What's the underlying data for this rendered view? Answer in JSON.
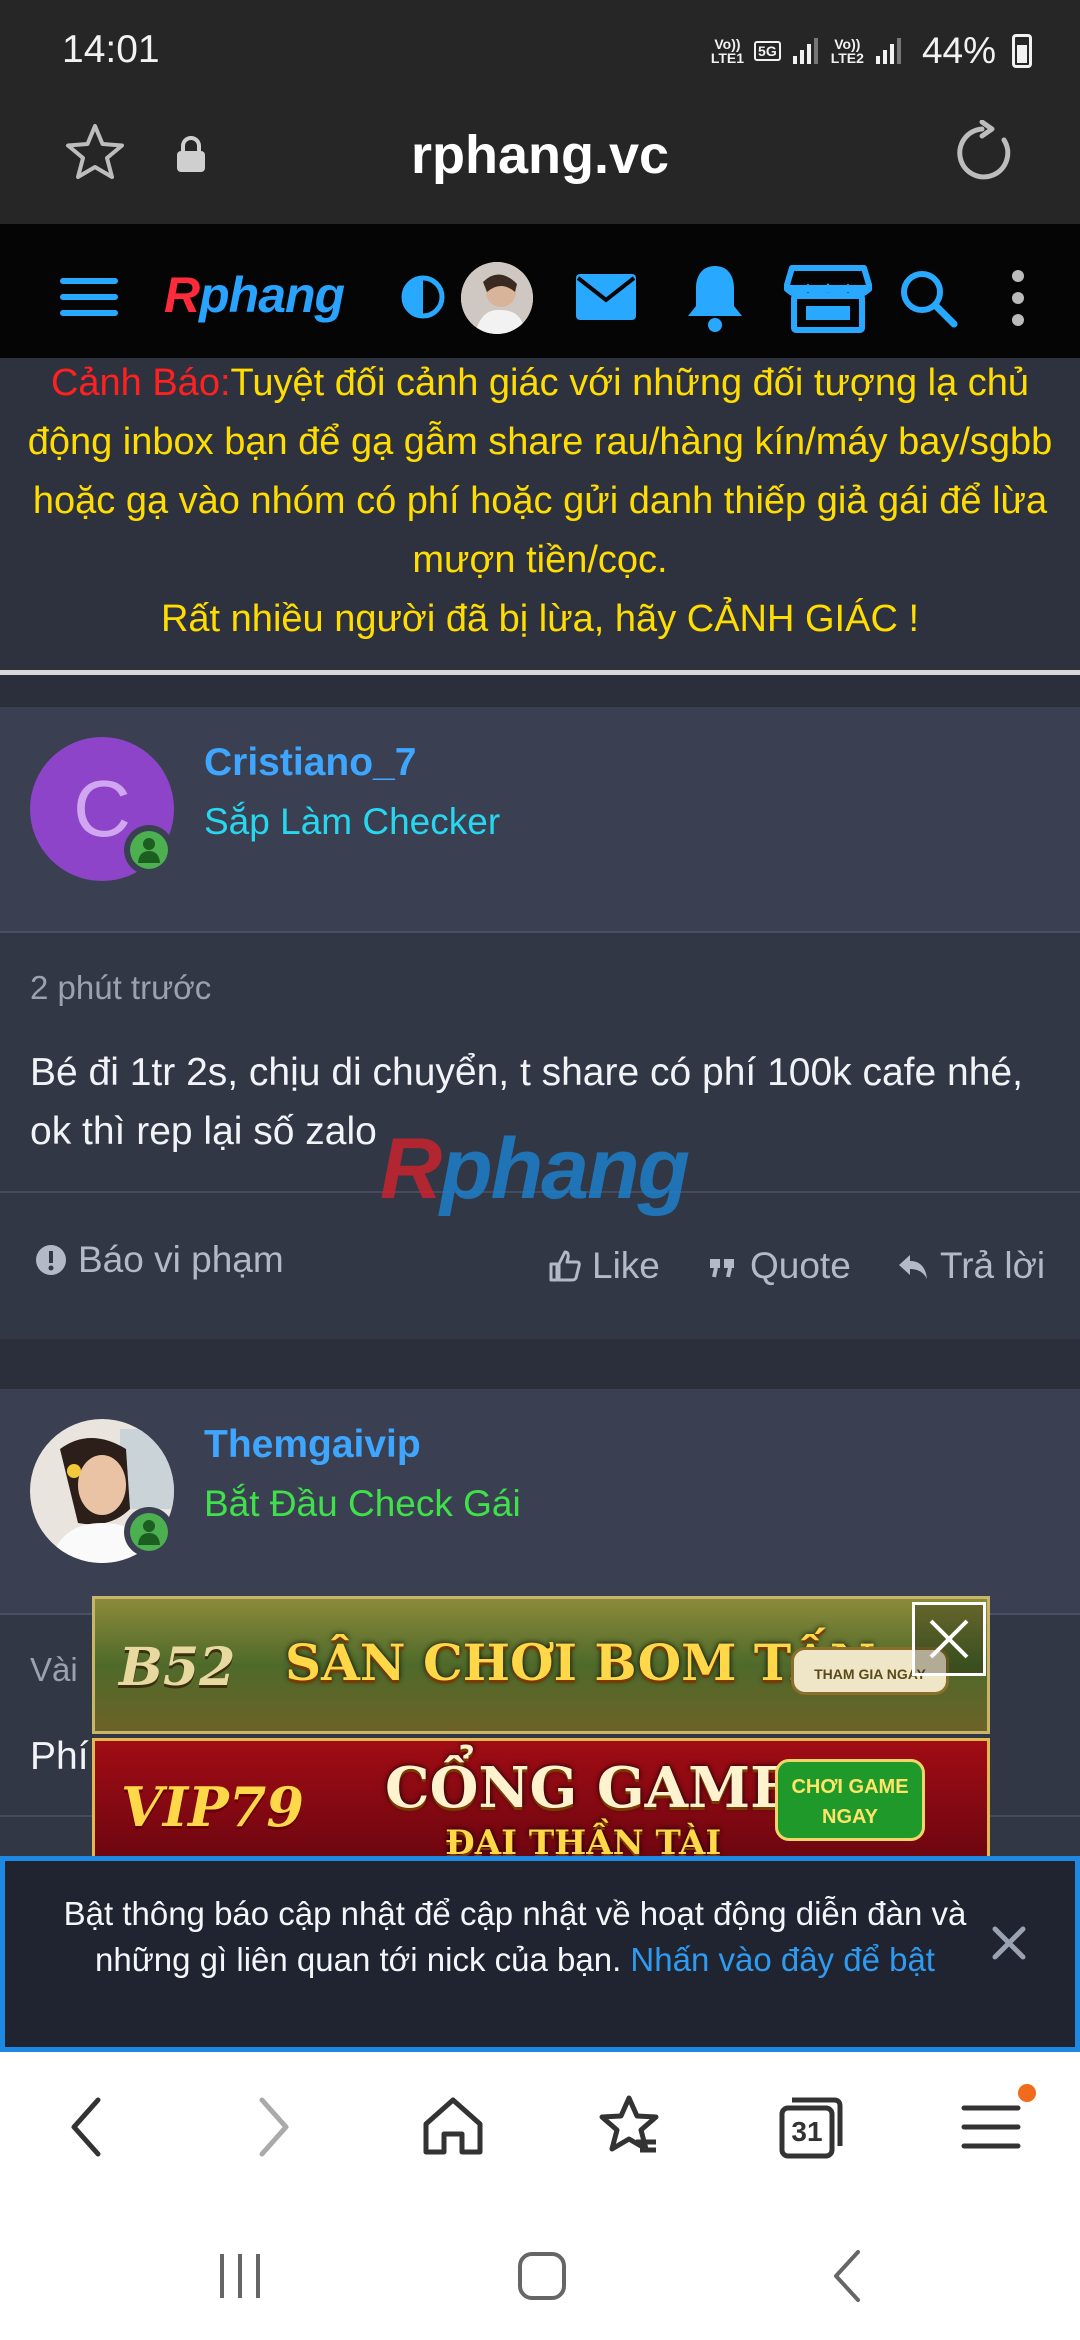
{
  "status_bar": {
    "time": "14:01",
    "network1": "Vo)) LTE1",
    "network_5g": "5G",
    "network2": "Vo)) LTE2",
    "battery": "44%"
  },
  "browser": {
    "url": "rphang.vc"
  },
  "site": {
    "logo_first": "R",
    "logo_rest": "phang"
  },
  "notice": {
    "warning_label": "Cảnh Báo:",
    "line1": "Tuyệt đối cảnh giác với những đối tượng lạ chủ động inbox bạn để gạ gẫm share rau/hàng kín/máy bay/sgbb hoặc gạ vào nhóm có phí hoặc gửi danh thiếp giả gái để lừa mượn tiền/cọc.",
    "line2": "Rất nhiều người đã bị lừa, hãy CẢNH GIÁC !"
  },
  "posts": [
    {
      "avatar_letter": "C",
      "username": "Cristiano_7",
      "user_title": "Sắp Làm Checker",
      "time": "2 phút trước",
      "body": "Bé đi 1tr 2s, chịu di chuyển, t share có phí 100k cafe nhé, ok thì rep lại số zalo",
      "report": "Báo vi phạm",
      "like": "Like",
      "quote": "Quote",
      "reply": "Trả lời"
    },
    {
      "username": "Themgaivip",
      "user_title": "Bắt Đầu Check Gái",
      "time": "Vài",
      "body": "Phí"
    }
  ],
  "watermark": {
    "first": "R",
    "rest": "phang"
  },
  "ads": {
    "ad1": {
      "brand": "B52",
      "headline": "SÂN CHƠI BOM TẤN",
      "cta": "THAM GIA NGAY"
    },
    "ad2": {
      "brand": "VIP79",
      "headline": "CỔNG GAME",
      "sub": "ĐẠI THẦN TÀI",
      "cta_line1": "CHƠI GAME",
      "cta_line2": "NGAY"
    }
  },
  "push_banner": {
    "text": "Bật thông báo cập nhật để cập nhật về hoạt động diễn đàn và những gì liên quan tới nick của bạn.",
    "link": "Nhấn vào đây để bật"
  },
  "bottom_nav": {
    "tabs_count": "31"
  },
  "colors": {
    "accent_blue": "#3ea6ff",
    "notice_yellow": "#ffdd00",
    "warning_red": "#ff2020",
    "title_cyan": "#27d7f0",
    "title_green": "#3fe04a",
    "avatar_purple": "#8e44c9",
    "online_green": "#4caf50"
  }
}
